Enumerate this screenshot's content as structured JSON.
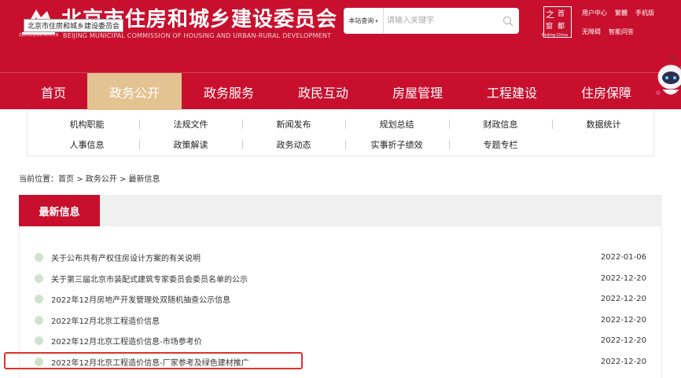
{
  "header": {
    "title": "北京市住房和城乡建设委员会",
    "subtitle": "BEIJING MUNICIPAL COMMISSION OF HOUSING AND URBAN-RURAL DEVELOPMENT",
    "url_caption": "ZJW.BEIJING.GOV.CN",
    "logo_tooltip": "北京市住房和城乡建设委员会",
    "seal_chars": [
      "之",
      "首",
      "窗",
      "都"
    ],
    "seal_caption": "Beijing·China",
    "brand_color": "#c8102e"
  },
  "search": {
    "scope_label": "本站查询",
    "placeholder": "请输入关键字",
    "button_icon": "search-icon"
  },
  "util_links": [
    "用户中心",
    "繁體",
    "手机版",
    "无障碍",
    "智能问答"
  ],
  "nav": {
    "items": [
      "首页",
      "政务公开",
      "政务服务",
      "政民互动",
      "房屋管理",
      "工程建设",
      "住房保障"
    ],
    "active": "政务公开",
    "active_color": "#e2c391"
  },
  "submenu": {
    "row1": [
      "机构职能",
      "法规文件",
      "新闻发布",
      "规划总结",
      "财政信息",
      "数据统计"
    ],
    "row2": [
      "人事信息",
      "政策解读",
      "政务动态",
      "实事折子绩效",
      "专题专栏"
    ]
  },
  "breadcrumb": {
    "prefix": "当前位置：",
    "items": [
      "首页",
      "政务公开",
      "最新信息"
    ],
    "separator": ">"
  },
  "section": {
    "title": "最新信息"
  },
  "news": [
    {
      "title": "关于公布共有产权住房设计方案的有关说明",
      "date": "2022-01-06"
    },
    {
      "title": "关于第三届北京市装配式建筑专家委员会委员名单的公示",
      "date": "2022-12-20"
    },
    {
      "title": "2022年12月房地产开发管理处双随机抽查公示信息",
      "date": "2022-12-20"
    },
    {
      "title": "2022年12月北京工程造价信息",
      "date": "2022-12-20"
    },
    {
      "title": "2022年12月北京工程造价信息-市场参考价",
      "date": "2022-12-20"
    },
    {
      "title": "2022年12月北京工程造价信息-厂家参考及绿色建材推广",
      "date": "2022-12-20"
    }
  ],
  "highlight_color": "#e0312a"
}
